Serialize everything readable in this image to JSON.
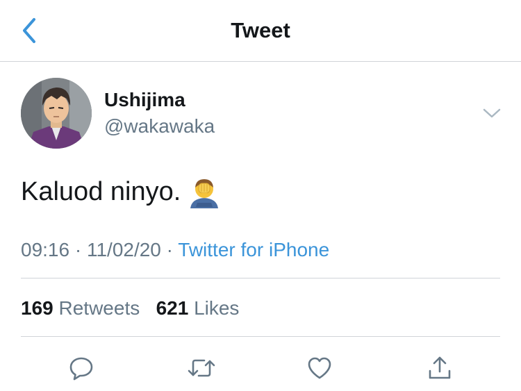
{
  "header": {
    "title": "Tweet",
    "back_icon": "chevron-left-icon"
  },
  "colors": {
    "link": "#3b94d9",
    "secondary_text": "#657786",
    "primary_text": "#14171a",
    "divider": "#d0d4d8"
  },
  "author": {
    "display_name": "Ushijima",
    "handle": "@wakawaka",
    "avatar_icon": "profile-avatar",
    "more_icon": "chevron-down-icon"
  },
  "tweet": {
    "text": "Kaluod ninyo.",
    "emoji": "face-palm-emoji"
  },
  "meta": {
    "time": "09:16",
    "separator": "·",
    "date": "11/02/20",
    "source": "Twitter for iPhone"
  },
  "stats": {
    "retweets_count": "169",
    "retweets_label": "Retweets",
    "likes_count": "621",
    "likes_label": "Likes"
  },
  "actions": [
    {
      "name": "reply",
      "icon": "comment-icon"
    },
    {
      "name": "retweet",
      "icon": "retweet-icon"
    },
    {
      "name": "like",
      "icon": "heart-icon"
    },
    {
      "name": "share",
      "icon": "share-icon"
    }
  ]
}
